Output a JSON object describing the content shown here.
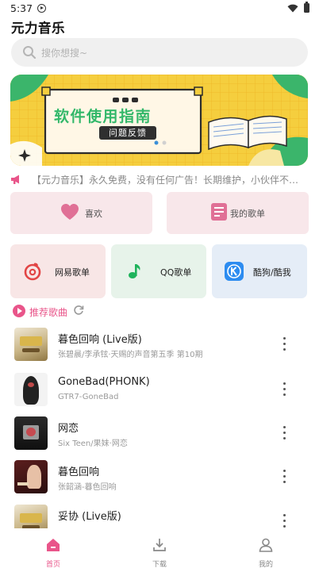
{
  "status_bar": {
    "time": "5:37"
  },
  "app": {
    "title": "元力音乐"
  },
  "search": {
    "placeholder": "搜你想搜~"
  },
  "banner": {
    "title": "软件使用指南",
    "button_label": "问题反馈"
  },
  "notice": {
    "text": "【元力音乐】永久免费，没有任何广告！长期维护，小伙伴不…"
  },
  "quick_actions": [
    {
      "label": "喜欢",
      "icon": "heart-icon"
    },
    {
      "label": "我的歌单",
      "icon": "playlist-icon"
    }
  ],
  "platforms": [
    {
      "label": "网易歌单",
      "icon": "netease-icon"
    },
    {
      "label": "QQ歌单",
      "icon": "qq-music-icon"
    },
    {
      "label": "酷狗/酷我",
      "icon": "kugou-icon"
    }
  ],
  "recommend": {
    "title": "推荐歌曲"
  },
  "songs": [
    {
      "title": "暮色回响 (Live版)",
      "subtitle": "张碧晨/李承铉·天赐的声音第五季 第10期"
    },
    {
      "title": "GoneBad(PHONK)",
      "subtitle": "GTR7-GoneBad"
    },
    {
      "title": "网恋",
      "subtitle": "Six Teen/果妹·网恋"
    },
    {
      "title": "暮色回响",
      "subtitle": "张韶涵-暮色回响"
    },
    {
      "title": "妥协 (Live版)",
      "subtitle": ""
    }
  ],
  "tabs": [
    {
      "label": "首页",
      "icon": "home-icon",
      "active": true
    },
    {
      "label": "下载",
      "icon": "download-icon",
      "active": false
    },
    {
      "label": "我的",
      "icon": "profile-icon",
      "active": false
    }
  ],
  "colors": {
    "accent": "#e9558a",
    "banner_bg": "#f5ce3e",
    "banner_title": "#33b86a",
    "netease": "#e24545",
    "qq": "#1fb35c",
    "kugou": "#2d8cf0"
  }
}
